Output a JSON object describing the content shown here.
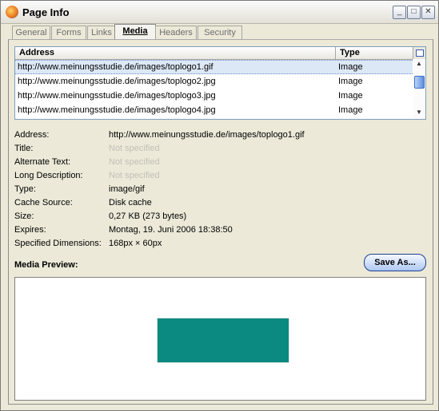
{
  "window": {
    "title": "Page Info",
    "controls": {
      "minimize": "_",
      "maximize": "□",
      "close": "✕"
    }
  },
  "tabs": [
    {
      "label": "General"
    },
    {
      "label": "Forms"
    },
    {
      "label": "Links"
    },
    {
      "label": "Media",
      "active": true
    },
    {
      "label": "Headers"
    },
    {
      "label": "Security"
    }
  ],
  "media_list": {
    "columns": {
      "address": "Address",
      "type": "Type"
    },
    "rows": [
      {
        "address": "http://www.meinungsstudie.de/images/toplogo1.gif",
        "type": "Image",
        "selected": true
      },
      {
        "address": "http://www.meinungsstudie.de/images/toplogo2.jpg",
        "type": "Image"
      },
      {
        "address": "http://www.meinungsstudie.de/images/toplogo3.jpg",
        "type": "Image"
      },
      {
        "address": "http://www.meinungsstudie.de/images/toplogo4.jpg",
        "type": "Image"
      }
    ]
  },
  "properties": {
    "address": {
      "label": "Address:",
      "value": "http://www.meinungsstudie.de/images/toplogo1.gif"
    },
    "title": {
      "label": "Title:",
      "value": "Not specified"
    },
    "alt_text": {
      "label": "Alternate Text:",
      "value": "Not specified"
    },
    "long_desc": {
      "label": "Long Description:",
      "value": "Not specified"
    },
    "type": {
      "label": "Type:",
      "value": "image/gif"
    },
    "cache_source": {
      "label": "Cache Source:",
      "value": "Disk cache"
    },
    "size": {
      "label": "Size:",
      "value": "0,27 KB (273 bytes)"
    },
    "expires": {
      "label": "Expires:",
      "value": "Montag, 19. Juni 2006 18:38:50"
    },
    "dimensions": {
      "label": "Specified Dimensions:",
      "value": "168px × 60px"
    }
  },
  "preview": {
    "label": "Media Preview:",
    "save_button": "Save As...",
    "image_color": "#0a8a80"
  }
}
